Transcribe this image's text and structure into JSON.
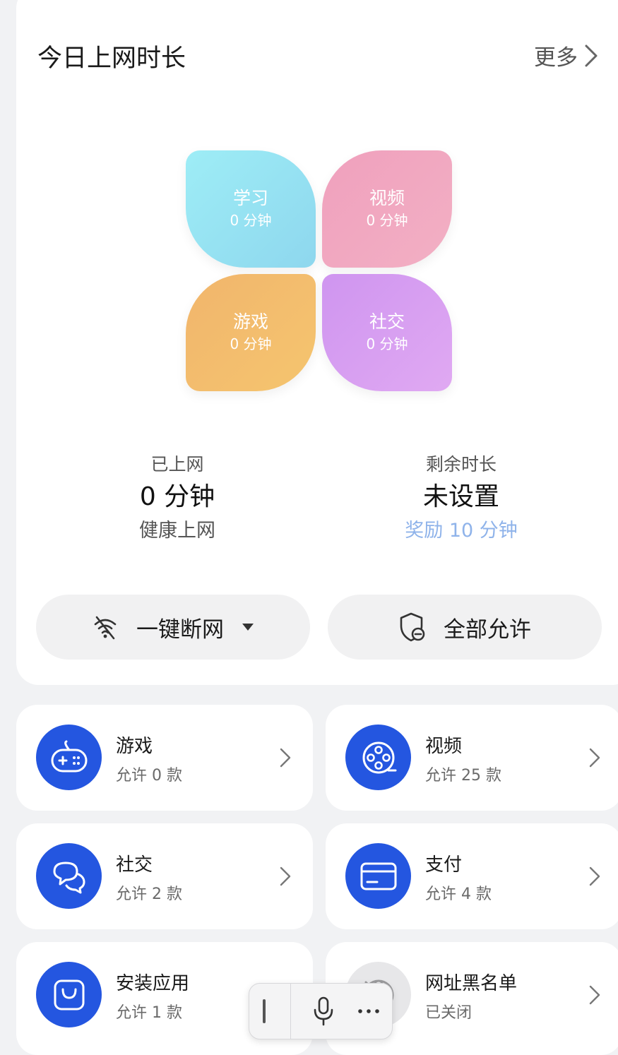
{
  "card": {
    "title": "今日上网时长",
    "more_label": "更多"
  },
  "petals": [
    {
      "name": "学习",
      "value": "0 分钟"
    },
    {
      "name": "视频",
      "value": "0 分钟"
    },
    {
      "name": "游戏",
      "value": "0 分钟"
    },
    {
      "name": "社交",
      "value": "0 分钟"
    }
  ],
  "stats": {
    "online": {
      "label": "已上网",
      "value": "0 分钟",
      "sub": "健康上网"
    },
    "remaining": {
      "label": "剩余时长",
      "value": "未设置",
      "sub": "奖励 10 分钟"
    }
  },
  "buttons": {
    "disconnect": "一键断网",
    "allow_all": "全部允许"
  },
  "tiles": [
    {
      "name": "游戏",
      "sub": "允许 0 款",
      "icon": "gamepad-icon"
    },
    {
      "name": "视频",
      "sub": "允许 25 款",
      "icon": "film-reel-icon"
    },
    {
      "name": "社交",
      "sub": "允许 2 款",
      "icon": "chat-bubbles-icon"
    },
    {
      "name": "支付",
      "sub": "允许 4 款",
      "icon": "card-icon"
    },
    {
      "name": "安装应用",
      "sub": "允许 1 款",
      "icon": "shopping-bag-icon"
    },
    {
      "name": "网址黑名单",
      "sub": "已关闭",
      "icon": "blocked-globe-icon"
    }
  ],
  "colors": {
    "accent_blue": "#2456e0",
    "reward_text": "#8fb3ea"
  }
}
